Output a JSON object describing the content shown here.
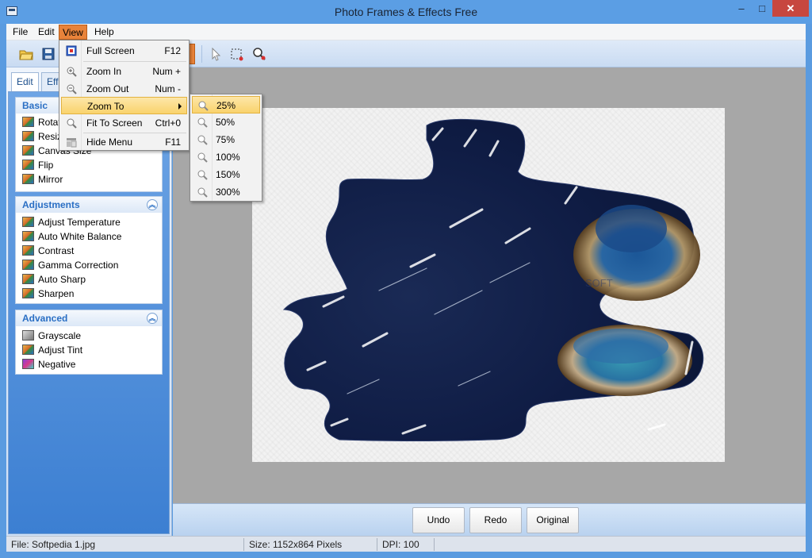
{
  "window": {
    "title": "Photo Frames & Effects Free",
    "minimize": "–",
    "maximize": "□",
    "close": "✕"
  },
  "menubar": [
    {
      "label": "File"
    },
    {
      "label": "Edit"
    },
    {
      "label": "View"
    },
    {
      "label": "Help"
    }
  ],
  "view_menu": {
    "items": [
      {
        "label": "Full Screen",
        "shortcut": "F12",
        "icon": "fullscreen-icon"
      },
      {
        "label": "Zoom In",
        "shortcut": "Num +",
        "icon": "zoom-in-icon"
      },
      {
        "label": "Zoom Out",
        "shortcut": "Num -",
        "icon": "zoom-out-icon"
      },
      {
        "label": "Zoom To",
        "shortcut": "",
        "icon": ""
      },
      {
        "label": "Fit To Screen",
        "shortcut": "Ctrl+0",
        "icon": "fit-screen-icon"
      },
      {
        "label": "Hide Menu",
        "shortcut": "F11",
        "icon": "hide-menu-icon"
      }
    ]
  },
  "zoom_submenu": {
    "items": [
      "25%",
      "50%",
      "75%",
      "100%",
      "150%",
      "300%"
    ],
    "highlighted": "25%"
  },
  "left_panel": {
    "tabs": [
      "Edit",
      "Effe"
    ],
    "basic": {
      "title": "Basic",
      "items": [
        "Rotat",
        "Resiz",
        "Canvas Size",
        "Flip",
        "Mirror"
      ]
    },
    "adjustments": {
      "title": "Adjustments",
      "items": [
        "Adjust Temperature",
        "Auto White Balance",
        "Contrast",
        "Gamma Correction",
        "Auto Sharp",
        "Sharpen"
      ]
    },
    "advanced": {
      "title": "Advanced",
      "items": [
        "Grayscale",
        "Adjust Tint",
        "Negative"
      ]
    }
  },
  "actions": {
    "undo": "Undo",
    "redo": "Redo",
    "original": "Original"
  },
  "status": {
    "file": "File: Softpedia 1.jpg",
    "size": "Size: 1152x864 Pixels",
    "dpi": "DPI: 100"
  },
  "colors": {
    "titlebar": "#5b9ee4",
    "accent": "#e8833a",
    "panel": "#3c7fd2",
    "canvas": "#a7a7a7"
  }
}
